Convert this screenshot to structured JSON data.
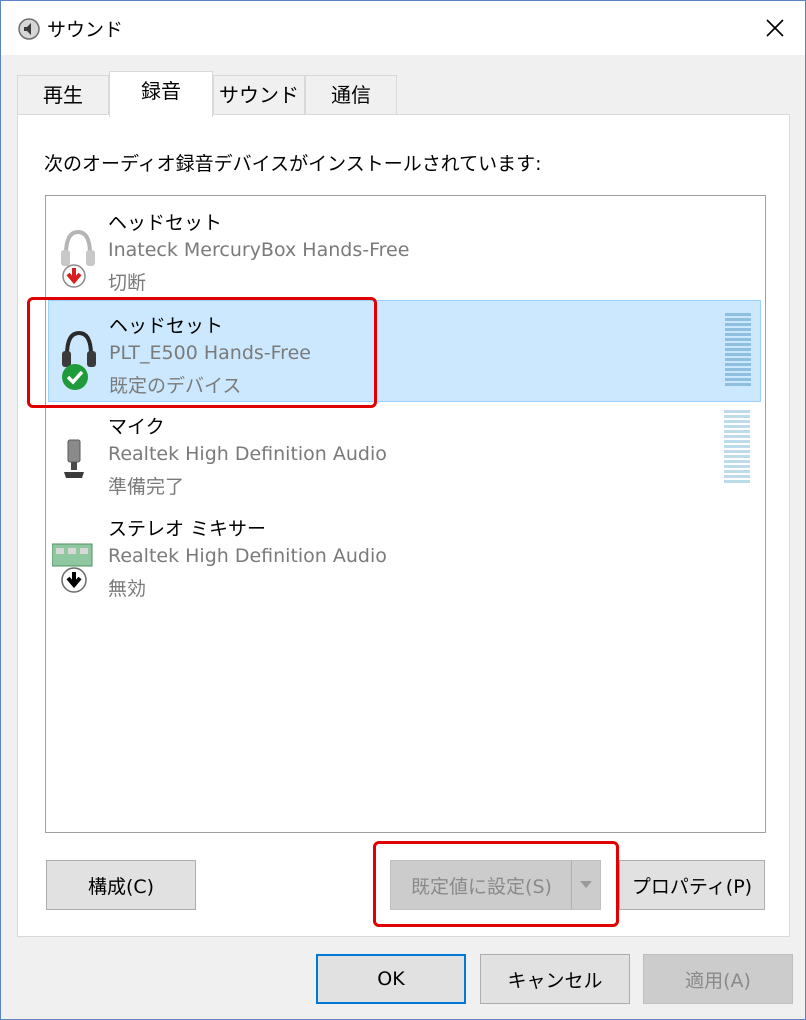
{
  "window": {
    "title": "サウンド",
    "close_glyph": "✕"
  },
  "tabs": [
    {
      "label": "再生",
      "active": false
    },
    {
      "label": "録音",
      "active": true
    },
    {
      "label": "サウンド",
      "active": false
    },
    {
      "label": "通信",
      "active": false
    }
  ],
  "panel": {
    "instruction": "次のオーディオ録音デバイスがインストールされています:"
  },
  "devices": [
    {
      "name": "ヘッドセット",
      "driver": "Inateck MercuryBox Hands-Free",
      "status": "切断",
      "icon": "headset-disconnected-icon",
      "selected": false
    },
    {
      "name": "ヘッドセット",
      "driver": "PLT_E500 Hands-Free",
      "status": "既定のデバイス",
      "icon": "headset-default-icon",
      "selected": true
    },
    {
      "name": "マイク",
      "driver": "Realtek High Definition Audio",
      "status": "準備完了",
      "icon": "microphone-icon",
      "selected": false
    },
    {
      "name": "ステレオ ミキサー",
      "driver": "Realtek High Definition Audio",
      "status": "無効",
      "icon": "stereo-mixer-icon",
      "selected": false
    }
  ],
  "buttons": {
    "configure": "構成(C)",
    "set_default": "既定値に設定(S)",
    "properties": "プロパティ(P)",
    "ok": "OK",
    "cancel": "キャンセル",
    "apply": "適用(A)"
  },
  "colors": {
    "selection_bg": "#cce8ff",
    "highlight_red": "#e00000",
    "default_button_border": "#0078d7",
    "check_green": "#1f9b3b",
    "disconnect_red": "#d81e1e"
  }
}
